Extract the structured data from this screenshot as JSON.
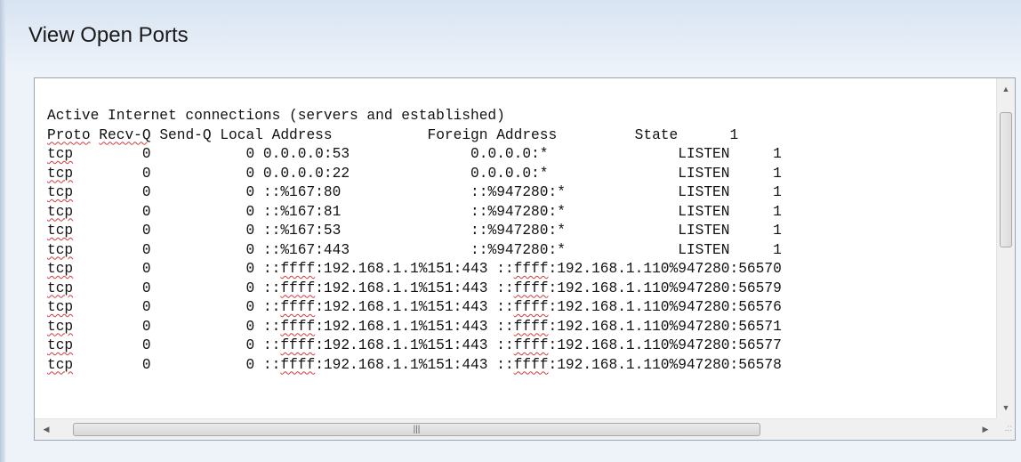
{
  "page": {
    "title": "View Open Ports"
  },
  "output": {
    "heading": "Active Internet connections (servers and established)",
    "columns": [
      "Proto",
      "Recv-Q",
      "Send-Q",
      "Local Address",
      "Foreign Address",
      "State"
    ],
    "rows": [
      {
        "proto": "tcp",
        "recv_q": "0",
        "send_q": "0",
        "local": "0.0.0.0:53",
        "foreign": "0.0.0.0:*",
        "state": "LISTEN",
        "tail": "1"
      },
      {
        "proto": "tcp",
        "recv_q": "0",
        "send_q": "0",
        "local": "0.0.0.0:22",
        "foreign": "0.0.0.0:*",
        "state": "LISTEN",
        "tail": "1"
      },
      {
        "proto": "tcp",
        "recv_q": "0",
        "send_q": "0",
        "local": "::%167:80",
        "foreign": "::%947280:*",
        "state": "LISTEN",
        "tail": "1"
      },
      {
        "proto": "tcp",
        "recv_q": "0",
        "send_q": "0",
        "local": "::%167:81",
        "foreign": "::%947280:*",
        "state": "LISTEN",
        "tail": "1"
      },
      {
        "proto": "tcp",
        "recv_q": "0",
        "send_q": "0",
        "local": "::%167:53",
        "foreign": "::%947280:*",
        "state": "LISTEN",
        "tail": "1"
      },
      {
        "proto": "tcp",
        "recv_q": "0",
        "send_q": "0",
        "local": "::%167:443",
        "foreign": "::%947280:*",
        "state": "LISTEN",
        "tail": "1"
      },
      {
        "proto": "tcp",
        "recv_q": "0",
        "send_q": "0",
        "local": "::ffff:192.168.1.1%151:443",
        "foreign": "::ffff:192.168.1.110%947280:56570",
        "state": "",
        "tail": ""
      },
      {
        "proto": "tcp",
        "recv_q": "0",
        "send_q": "0",
        "local": "::ffff:192.168.1.1%151:443",
        "foreign": "::ffff:192.168.1.110%947280:56579",
        "state": "",
        "tail": ""
      },
      {
        "proto": "tcp",
        "recv_q": "0",
        "send_q": "0",
        "local": "::ffff:192.168.1.1%151:443",
        "foreign": "::ffff:192.168.1.110%947280:56576",
        "state": "",
        "tail": ""
      },
      {
        "proto": "tcp",
        "recv_q": "0",
        "send_q": "0",
        "local": "::ffff:192.168.1.1%151:443",
        "foreign": "::ffff:192.168.1.110%947280:56571",
        "state": "",
        "tail": ""
      },
      {
        "proto": "tcp",
        "recv_q": "0",
        "send_q": "0",
        "local": "::ffff:192.168.1.1%151:443",
        "foreign": "::ffff:192.168.1.110%947280:56577",
        "state": "",
        "tail": ""
      },
      {
        "proto": "tcp",
        "recv_q": "0",
        "send_q": "0",
        "local": "::ffff:192.168.1.1%151:443",
        "foreign": "::ffff:192.168.1.110%947280:56578",
        "state": "",
        "tail": ""
      }
    ]
  },
  "scrollbars": {
    "vertical_up_icon": "up-arrow-icon",
    "vertical_down_icon": "down-arrow-icon",
    "horizontal_left_icon": "left-arrow-icon",
    "horizontal_right_icon": "right-arrow-icon"
  }
}
